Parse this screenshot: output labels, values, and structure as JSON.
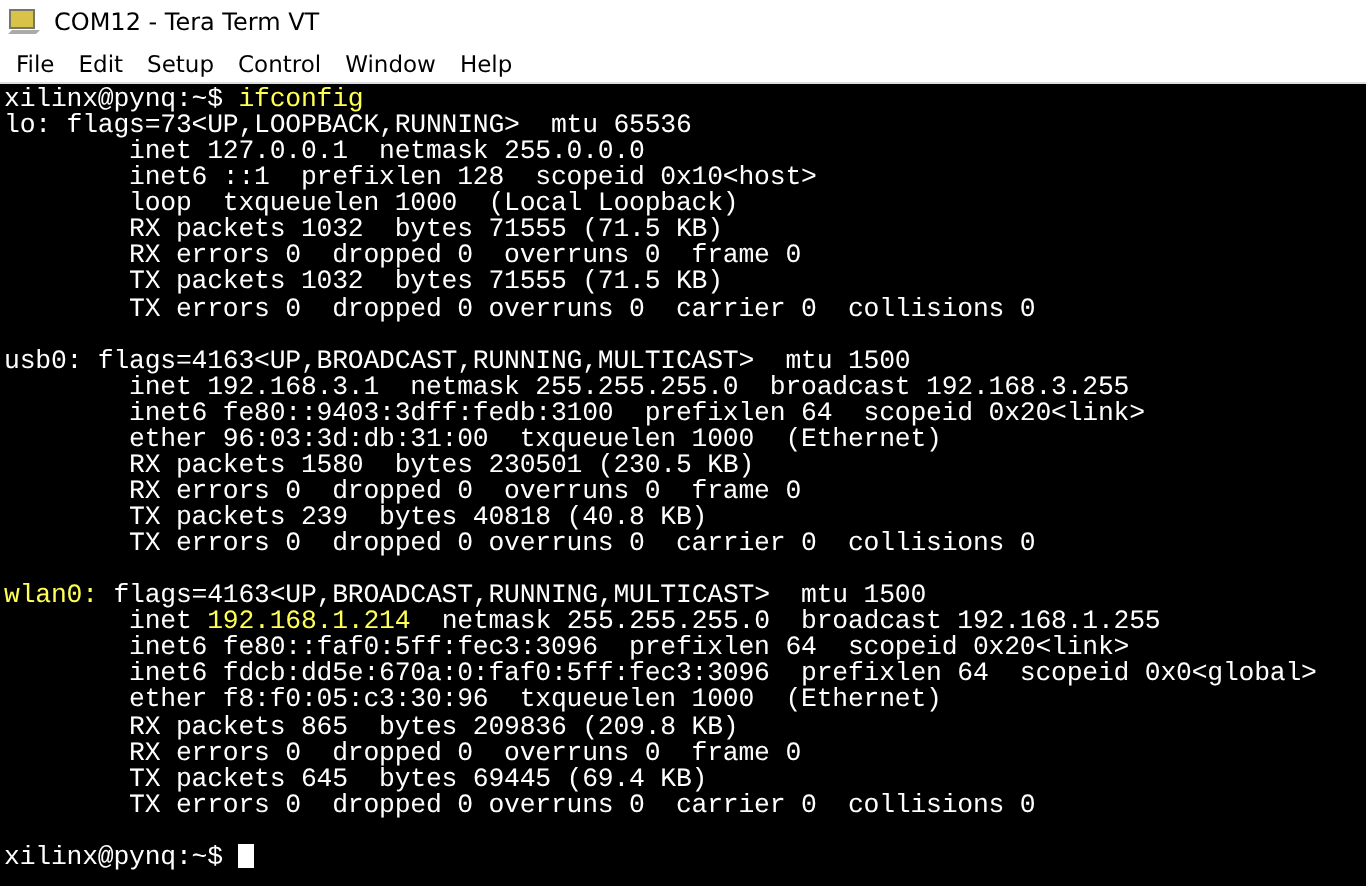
{
  "window": {
    "title": "COM12 - Tera Term VT"
  },
  "menu": [
    "File",
    "Edit",
    "Setup",
    "Control",
    "Window",
    "Help"
  ],
  "terminal": {
    "lines": [
      {
        "kind": "text",
        "segments": [
          {
            "text": "xilinx@pynq:~$ ",
            "color": "#ffffff"
          },
          {
            "text": "ifconfig",
            "color": "#ffff55"
          }
        ]
      },
      {
        "kind": "text",
        "segments": [
          {
            "text": "lo: flags=73<UP,LOOPBACK,RUNNING>  mtu 65536",
            "color": "#ffffff"
          }
        ]
      },
      {
        "kind": "text",
        "segments": [
          {
            "text": "        inet 127.0.0.1  netmask 255.0.0.0",
            "color": "#ffffff"
          }
        ]
      },
      {
        "kind": "text",
        "segments": [
          {
            "text": "        inet6 ::1  prefixlen 128  scopeid 0x10<host>",
            "color": "#ffffff"
          }
        ]
      },
      {
        "kind": "text",
        "segments": [
          {
            "text": "        loop  txqueuelen 1000  (Local Loopback)",
            "color": "#ffffff"
          }
        ]
      },
      {
        "kind": "text",
        "segments": [
          {
            "text": "        RX packets 1032  bytes 71555 (71.5 KB)",
            "color": "#ffffff"
          }
        ]
      },
      {
        "kind": "text",
        "segments": [
          {
            "text": "        RX errors 0  dropped 0  overruns 0  frame 0",
            "color": "#ffffff"
          }
        ]
      },
      {
        "kind": "text",
        "segments": [
          {
            "text": "        TX packets 1032  bytes 71555 (71.5 KB)",
            "color": "#ffffff"
          }
        ]
      },
      {
        "kind": "text",
        "segments": [
          {
            "text": "        TX errors 0  dropped 0 overruns 0  carrier 0  collisions 0",
            "color": "#ffffff"
          }
        ]
      },
      {
        "kind": "blank"
      },
      {
        "kind": "text",
        "segments": [
          {
            "text": "usb0: flags=4163<UP,BROADCAST,RUNNING,MULTICAST>  mtu 1500",
            "color": "#ffffff"
          }
        ]
      },
      {
        "kind": "text",
        "segments": [
          {
            "text": "        inet 192.168.3.1  netmask 255.255.255.0  broadcast 192.168.3.255",
            "color": "#ffffff"
          }
        ]
      },
      {
        "kind": "text",
        "segments": [
          {
            "text": "        inet6 fe80::9403:3dff:fedb:3100  prefixlen 64  scopeid 0x20<link>",
            "color": "#ffffff"
          }
        ]
      },
      {
        "kind": "text",
        "segments": [
          {
            "text": "        ether 96:03:3d:db:31:00  txqueuelen 1000  (Ethernet)",
            "color": "#ffffff"
          }
        ]
      },
      {
        "kind": "text",
        "segments": [
          {
            "text": "        RX packets 1580  bytes 230501 (230.5 KB)",
            "color": "#ffffff"
          }
        ]
      },
      {
        "kind": "text",
        "segments": [
          {
            "text": "        RX errors 0  dropped 0  overruns 0  frame 0",
            "color": "#ffffff"
          }
        ]
      },
      {
        "kind": "text",
        "segments": [
          {
            "text": "        TX packets 239  bytes 40818 (40.8 KB)",
            "color": "#ffffff"
          }
        ]
      },
      {
        "kind": "text",
        "segments": [
          {
            "text": "        TX errors 0  dropped 0 overruns 0  carrier 0  collisions 0",
            "color": "#ffffff"
          }
        ]
      },
      {
        "kind": "blank"
      },
      {
        "kind": "text",
        "segments": [
          {
            "text": "wlan0:",
            "color": "#ffff55"
          },
          {
            "text": " flags=4163<UP,BROADCAST,RUNNING,MULTICAST>  mtu 1500",
            "color": "#ffffff"
          }
        ]
      },
      {
        "kind": "text",
        "segments": [
          {
            "text": "        inet ",
            "color": "#ffffff"
          },
          {
            "text": "192.168.1.214",
            "color": "#ffff55"
          },
          {
            "text": "  netmask 255.255.255.0  broadcast 192.168.1.255",
            "color": "#ffffff"
          }
        ]
      },
      {
        "kind": "text",
        "segments": [
          {
            "text": "        inet6 fe80::faf0:5ff:fec3:3096  prefixlen 64  scopeid 0x20<link>",
            "color": "#ffffff"
          }
        ]
      },
      {
        "kind": "text",
        "segments": [
          {
            "text": "        inet6 fdcb:dd5e:670a:0:faf0:5ff:fec3:3096  prefixlen 64  scopeid 0x0<global>",
            "color": "#ffffff"
          }
        ]
      },
      {
        "kind": "text",
        "segments": [
          {
            "text": "        ether f8:f0:05:c3:30:96  txqueuelen 1000  (Ethernet)",
            "color": "#ffffff"
          }
        ]
      },
      {
        "kind": "text",
        "segments": [
          {
            "text": "        RX packets 865  bytes 209836 (209.8 KB)",
            "color": "#ffffff"
          }
        ]
      },
      {
        "kind": "text",
        "segments": [
          {
            "text": "        RX errors 0  dropped 0  overruns 0  frame 0",
            "color": "#ffffff"
          }
        ]
      },
      {
        "kind": "text",
        "segments": [
          {
            "text": "        TX packets 645  bytes 69445 (69.4 KB)",
            "color": "#ffffff"
          }
        ]
      },
      {
        "kind": "text",
        "segments": [
          {
            "text": "        TX errors 0  dropped 0 overruns 0  carrier 0  collisions 0",
            "color": "#ffffff"
          }
        ]
      },
      {
        "kind": "blank"
      },
      {
        "kind": "text",
        "cursor": true,
        "segments": [
          {
            "text": "xilinx@pynq:~$ ",
            "color": "#ffffff"
          }
        ]
      }
    ]
  }
}
